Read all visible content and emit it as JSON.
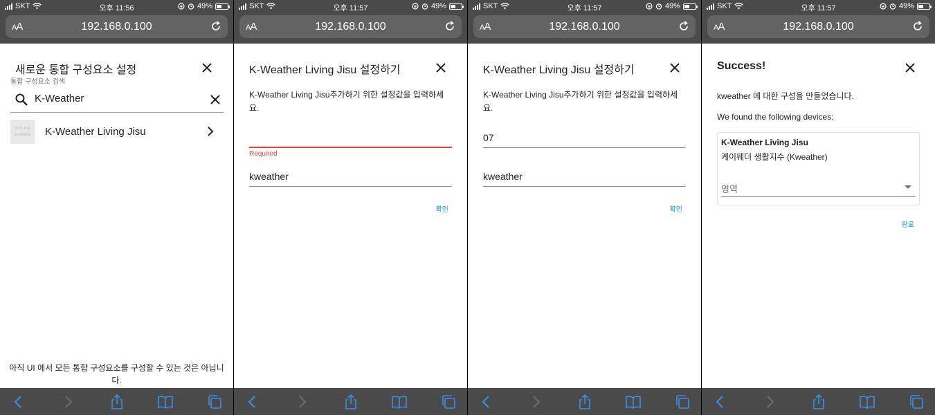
{
  "status": [
    {
      "carrier": "SKT",
      "time": "오후 11:56",
      "battery": "49%",
      "battery_level": 0.49
    },
    {
      "carrier": "SKT",
      "time": "오후 11:57",
      "battery": "49%",
      "battery_level": 0.49
    },
    {
      "carrier": "SKT",
      "time": "오후 11:57",
      "battery": "49%",
      "battery_level": 0.49
    },
    {
      "carrier": "SKT",
      "time": "오후 11:57",
      "battery": "49%",
      "battery_level": 0.49
    }
  ],
  "browser": {
    "aa_label_small": "A",
    "aa_label_big": "A",
    "url": "192.168.0.100"
  },
  "screen1": {
    "title": "새로운 통합 구성요소 설정",
    "search_label": "통합 구성요소 검색",
    "search_value": "K-Weather",
    "result_icon_text": "icon not available",
    "result_label": "K-Weather Living Jisu",
    "footer_note": "아직 UI 에서 모든 통합 구성요소를 구성할 수 있는 것은 아닙니다."
  },
  "screen2": {
    "title": "K-Weather Living Jisu 설정하기",
    "description": "K-Weather Living Jisu추가하기 위한 설정값을 입력하세요.",
    "field1_value": "",
    "field1_error": "Required",
    "field2_value": "kweather",
    "submit_label": "확인"
  },
  "screen3": {
    "title": "K-Weather Living Jisu 설정하기",
    "description": "K-Weather Living Jisu추가하기 위한 설정값을 입력하세요.",
    "field1_value": "07",
    "field2_value": "kweather",
    "submit_label": "확인"
  },
  "screen4": {
    "title": "Success!",
    "message": "kweather 에 대한 구성을 만들었습니다.",
    "found_text": "We found the following devices:",
    "device_name": "K-Weather Living Jisu",
    "device_model": "케이웨더 생활지수 (Kweather)",
    "area_placeholder": "영역",
    "finish_label": "완료"
  },
  "icons": {
    "close": "close-icon",
    "search": "search-icon",
    "clear": "clear-icon",
    "chevron": "chevron-right-icon",
    "reload": "reload-icon",
    "back": "back-icon",
    "forward": "forward-icon",
    "share": "share-icon",
    "bookmarks": "bookmarks-icon",
    "tabs": "tabs-icon"
  },
  "colors": {
    "chrome": "#4a4a4a",
    "accent": "#039be5",
    "error": "#db4437",
    "ios_blue": "#0a84ff"
  }
}
